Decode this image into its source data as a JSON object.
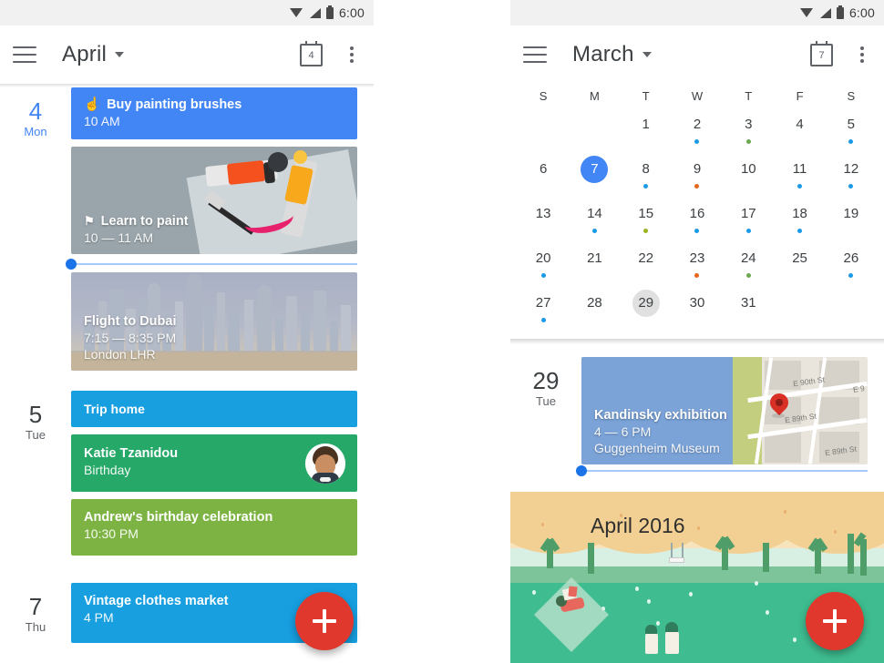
{
  "left": {
    "statusbar": {
      "time": "6:00",
      "icons": [
        "wifi-icon",
        "signal-icon",
        "battery-icon"
      ]
    },
    "appbar": {
      "menu_icon": "hamburger-menu-icon",
      "title": "April",
      "caret_icon": "chevron-down-icon",
      "today_icon": "calendar-today-icon",
      "today_number": "4",
      "more_icon": "overflow-menu-icon"
    },
    "days": [
      {
        "num": "4",
        "name": "Mon",
        "today": true,
        "events": [
          {
            "type": "solid",
            "color": "#4285f4",
            "icon": "tap-hand-icon",
            "title": "Buy painting brushes",
            "sub": "10 AM"
          },
          {
            "type": "photo",
            "image": "paint-supplies-photo",
            "icon": "flag-icon",
            "title": "Learn to paint",
            "sub": "10 — 11 AM"
          },
          {
            "type": "nowline"
          },
          {
            "type": "photo",
            "image": "dubai-skyline-photo",
            "title": "Flight to Dubai",
            "sub": "7:15 — 8:35 PM",
            "sub2": "London LHR"
          }
        ]
      },
      {
        "num": "5",
        "name": "Tue",
        "today": false,
        "events": [
          {
            "type": "solid",
            "color": "#179fe0",
            "title": "Trip home"
          },
          {
            "type": "solid",
            "color": "#25a868",
            "title": "Katie Tzanidou",
            "sub": "Birthday",
            "avatar": "contact-avatar"
          },
          {
            "type": "solid",
            "color": "#7cb342",
            "title": "Andrew's birthday celebration",
            "sub": "10:30 PM"
          }
        ]
      },
      {
        "num": "7",
        "name": "Thu",
        "today": false,
        "events": [
          {
            "type": "solid",
            "color": "#179fe0",
            "title": "Vintage clothes market",
            "sub": "4 PM",
            "avatar": "contact-avatar"
          }
        ]
      }
    ],
    "fab": {
      "icon": "add-icon",
      "color": "#e0382c"
    }
  },
  "right": {
    "statusbar": {
      "time": "6:00",
      "icons": [
        "wifi-icon",
        "signal-icon",
        "battery-icon"
      ]
    },
    "appbar": {
      "menu_icon": "hamburger-menu-icon",
      "title": "March",
      "caret_icon": "chevron-down-icon",
      "today_icon": "calendar-today-icon",
      "today_number": "7",
      "more_icon": "overflow-menu-icon"
    },
    "weekdays": [
      "S",
      "M",
      "T",
      "W",
      "T",
      "F",
      "S"
    ],
    "calendar": {
      "leading_blanks": 2,
      "days": [
        {
          "n": "1"
        },
        {
          "n": "2",
          "dot": "#1a9ae8"
        },
        {
          "n": "3",
          "dot": "#6aa84f"
        },
        {
          "n": "4"
        },
        {
          "n": "5",
          "dot": "#1a9ae8"
        },
        {
          "n": "6"
        },
        {
          "n": "7",
          "selected": true
        },
        {
          "n": "8",
          "dot": "#1a9ae8"
        },
        {
          "n": "9",
          "dot": "#e8661a"
        },
        {
          "n": "10"
        },
        {
          "n": "11",
          "dot": "#1a9ae8"
        },
        {
          "n": "12",
          "dot": "#1a9ae8"
        },
        {
          "n": "13"
        },
        {
          "n": "14",
          "dot": "#1a9ae8"
        },
        {
          "n": "15",
          "dot": "#9bb321"
        },
        {
          "n": "16",
          "dot": "#1a9ae8"
        },
        {
          "n": "17",
          "dot": "#1a9ae8"
        },
        {
          "n": "18",
          "dot": "#1a9ae8"
        },
        {
          "n": "19"
        },
        {
          "n": "20",
          "dot": "#1a9ae8"
        },
        {
          "n": "21"
        },
        {
          "n": "22"
        },
        {
          "n": "23",
          "dot": "#e8661a"
        },
        {
          "n": "24",
          "dot": "#6aa84f"
        },
        {
          "n": "25"
        },
        {
          "n": "26",
          "dot": "#1a9ae8"
        },
        {
          "n": "27",
          "dot": "#1a9ae8"
        },
        {
          "n": "28"
        },
        {
          "n": "29",
          "pressed": true
        },
        {
          "n": "30"
        },
        {
          "n": "31"
        }
      ]
    },
    "agenda_day": {
      "num": "29",
      "name": "Tue"
    },
    "event": {
      "image": "map-photo",
      "title": "Kandinsky exhibition",
      "sub": "4 — 6 PM",
      "sub2": "Guggenheim Museum",
      "map_streets": [
        "E 90th St",
        "E 89th St",
        "E 89th St",
        "E 9"
      ],
      "pin_icon": "map-pin-icon"
    },
    "banner": {
      "title": "April 2016",
      "image": "spring-park-illustration"
    },
    "fab": {
      "icon": "add-icon",
      "color": "#e0382c"
    }
  }
}
